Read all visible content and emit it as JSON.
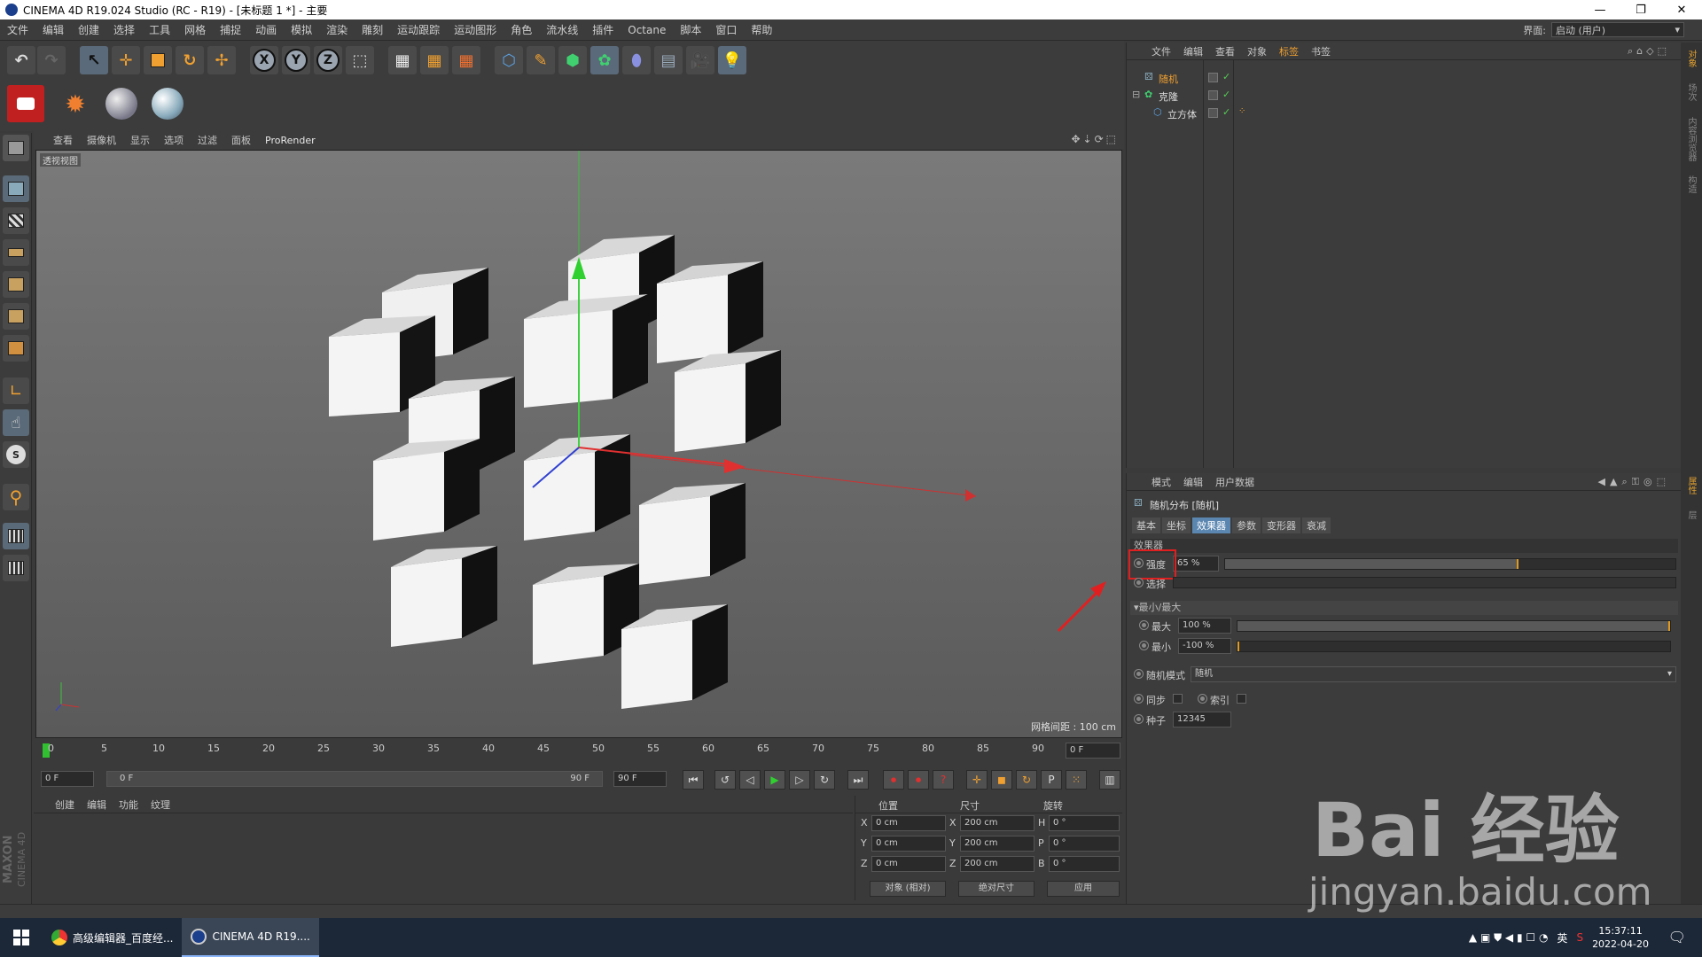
{
  "window": {
    "title": "CINEMA 4D R19.024 Studio (RC - R19) - [未标题 1 *] - 主要",
    "minimize": "—",
    "restore": "❐",
    "close": "✕"
  },
  "menu": {
    "items": [
      "文件",
      "编辑",
      "创建",
      "选择",
      "工具",
      "网格",
      "捕捉",
      "动画",
      "模拟",
      "渲染",
      "雕刻",
      "运动跟踪",
      "运动图形",
      "角色",
      "流水线",
      "插件",
      "Octane",
      "脚本",
      "窗口",
      "帮助"
    ],
    "layout_label": "界面:",
    "layout_value": "启动 (用户)"
  },
  "viewport": {
    "menu": [
      "查看",
      "摄像机",
      "显示",
      "选项",
      "过滤",
      "面板",
      "ProRender"
    ],
    "label": "透视视图",
    "grid_info": "网格间距 : 100 cm"
  },
  "timeline": {
    "ticks": [
      "0",
      "5",
      "10",
      "15",
      "20",
      "25",
      "30",
      "35",
      "40",
      "45",
      "50",
      "55",
      "60",
      "65",
      "70",
      "75",
      "80",
      "85",
      "90"
    ],
    "current_frame": "0 F"
  },
  "transport": {
    "start_field": "0 F",
    "range_start": "0 F",
    "range_end": "90 F",
    "end_field": "90 F"
  },
  "material_manager": {
    "menu": [
      "创建",
      "编辑",
      "功能",
      "纹理"
    ],
    "logo_line1": "MAXON",
    "logo_line2": "CINEMA 4D"
  },
  "coord_manager": {
    "headers": {
      "position": "位置",
      "size": "尺寸",
      "rotation": "旋转"
    },
    "rows": [
      {
        "axis": "X",
        "pos": "0 cm",
        "saxis": "X",
        "size": "200 cm",
        "raxis": "H",
        "rot": "0 °"
      },
      {
        "axis": "Y",
        "pos": "0 cm",
        "saxis": "Y",
        "size": "200 cm",
        "raxis": "P",
        "rot": "0 °"
      },
      {
        "axis": "Z",
        "pos": "0 cm",
        "saxis": "Z",
        "size": "200 cm",
        "raxis": "B",
        "rot": "0 °"
      }
    ],
    "mode1": "对象 (相对)",
    "mode2": "绝对尺寸",
    "apply": "应用"
  },
  "object_manager": {
    "menu": [
      "文件",
      "编辑",
      "查看",
      "对象",
      "标签",
      "书签"
    ],
    "active_menu": "标签",
    "objects": [
      {
        "name": "随机",
        "indent": 0
      },
      {
        "name": "克隆",
        "indent": 0
      },
      {
        "name": "立方体",
        "indent": 1
      }
    ]
  },
  "attribute_manager": {
    "menu": [
      "模式",
      "编辑",
      "用户数据"
    ],
    "object_title": "随机分布 [随机]",
    "tabs": [
      "基本",
      "坐标",
      "效果器",
      "参数",
      "变形器",
      "衰减"
    ],
    "active_tab": "效果器",
    "section_effector": "效果器",
    "strength_label": "强度",
    "strength_value": "65 %",
    "strength_fraction": 0.65,
    "selection_label": "选择",
    "minmax_section": "▾最小/最大",
    "max_label": "最大",
    "max_value": "100 %",
    "min_label": "最小",
    "min_value": "-100 %",
    "random_mode_label": "随机模式",
    "random_mode_value": "随机",
    "sync_label": "同步",
    "index_label": "索引",
    "seed_label": "种子",
    "seed_value": "12345"
  },
  "right_strip": [
    "对象",
    "场次",
    "内容浏览器",
    "构造",
    "属性",
    "层"
  ],
  "taskbar": {
    "apps": [
      {
        "label": "高级编辑器_百度经...",
        "active": false
      },
      {
        "label": "CINEMA 4D R19....",
        "active": true
      }
    ],
    "ime": "英",
    "time": "15:37:11",
    "date": "2022-04-20"
  },
  "watermark": {
    "brand": "Bai 经验",
    "url": "jingyan.baidu.com"
  },
  "colors": {
    "accent": "#e09a20",
    "active_tab": "#5a86b0",
    "highlight_box": "#e02020"
  }
}
